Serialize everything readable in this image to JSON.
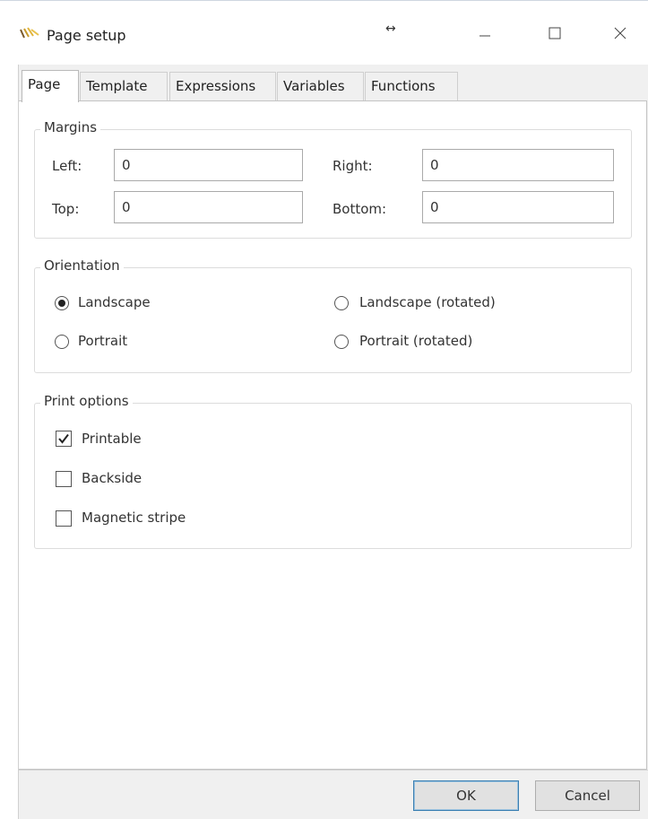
{
  "window": {
    "title": "Page setup",
    "drag_glyph": "↔",
    "icons": {
      "app": "page-setup-app-icon",
      "minimize": "minimize-icon",
      "maximize": "maximize-icon",
      "close": "close-icon"
    }
  },
  "tabs": [
    {
      "label": "Page",
      "active": true
    },
    {
      "label": "Template"
    },
    {
      "label": "Expressions"
    },
    {
      "label": "Variables"
    },
    {
      "label": "Functions"
    }
  ],
  "margins": {
    "legend": "Margins",
    "left": {
      "label": "Left:",
      "value": "0"
    },
    "right": {
      "label": "Right:",
      "value": "0"
    },
    "top": {
      "label": "Top:",
      "value": "0"
    },
    "bottom": {
      "label": "Bottom:",
      "value": "0"
    }
  },
  "orientation": {
    "legend": "Orientation",
    "options": [
      {
        "label": "Landscape",
        "checked": true
      },
      {
        "label": "Landscape (rotated)",
        "checked": false
      },
      {
        "label": "Portrait",
        "checked": false
      },
      {
        "label": "Portrait (rotated)",
        "checked": false
      }
    ]
  },
  "print_options": {
    "legend": "Print options",
    "items": [
      {
        "label": "Printable",
        "checked": true
      },
      {
        "label": "Backside",
        "checked": false
      },
      {
        "label": "Magnetic stripe",
        "checked": false
      }
    ]
  },
  "buttons": {
    "ok": "OK",
    "cancel": "Cancel"
  },
  "colors": {
    "ok_border": "#3c7fb1",
    "window_bg": "#f0f0f0",
    "panel_bg": "#ffffff"
  }
}
